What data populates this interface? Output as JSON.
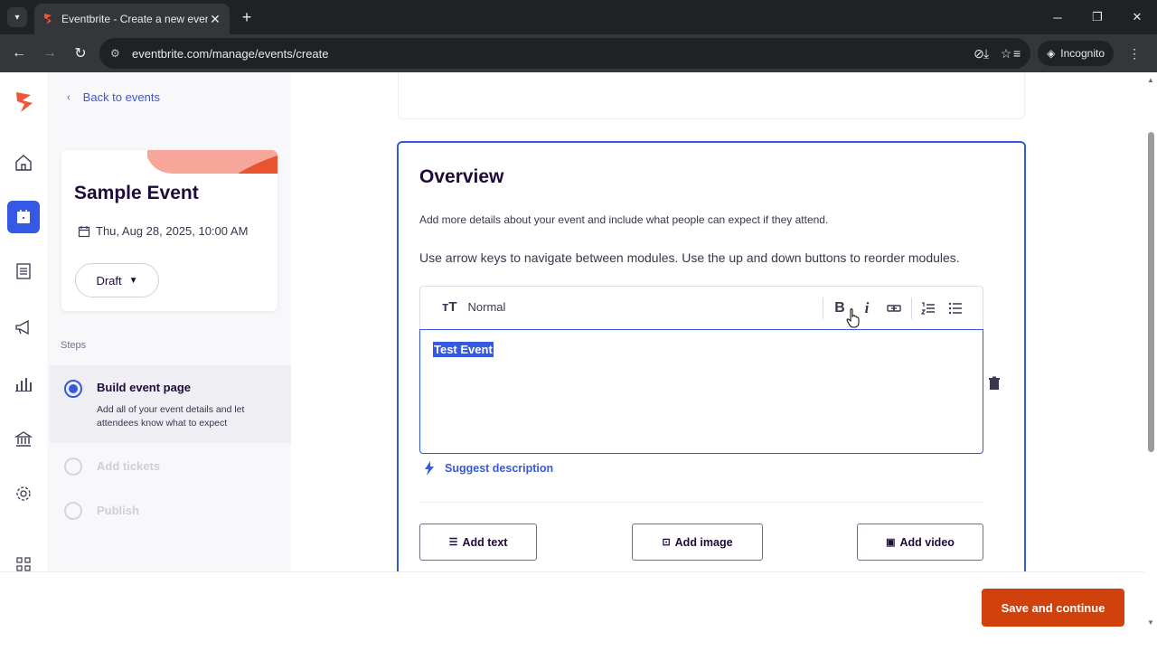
{
  "browser": {
    "tab_title": "Eventbrite - Create a new event",
    "url": "eventbrite.com/manage/events/create",
    "incognito_label": "Incognito"
  },
  "sidebar": {
    "back_label": "Back to events",
    "event": {
      "title": "Sample Event",
      "date": "Thu, Aug 28, 2025, 10:00 AM",
      "status": "Draft"
    },
    "steps_label": "Steps",
    "steps": [
      {
        "title": "Build event page",
        "description": "Add all of your event details and let attendees know what to expect",
        "state": "active"
      },
      {
        "title": "Add tickets",
        "state": "disabled"
      },
      {
        "title": "Publish",
        "state": "disabled"
      }
    ]
  },
  "overview": {
    "title": "Overview",
    "subtitle": "Add more details about your event and include what people can expect if they attend.",
    "hint": "Use arrow keys to navigate between modules. Use the up and down buttons to reorder modules.",
    "format_label": "Normal",
    "bold_label": "B",
    "italic_label": "i",
    "editor_text": "Test Event",
    "suggest_label": "Suggest description",
    "add_text_label": "Add text",
    "add_image_label": "Add image",
    "add_video_label": "Add video"
  },
  "footer": {
    "save_label": "Save and continue"
  },
  "colors": {
    "accent": "#3659e3",
    "brand": "#d1410c",
    "text_dark": "#1e0a3c"
  }
}
